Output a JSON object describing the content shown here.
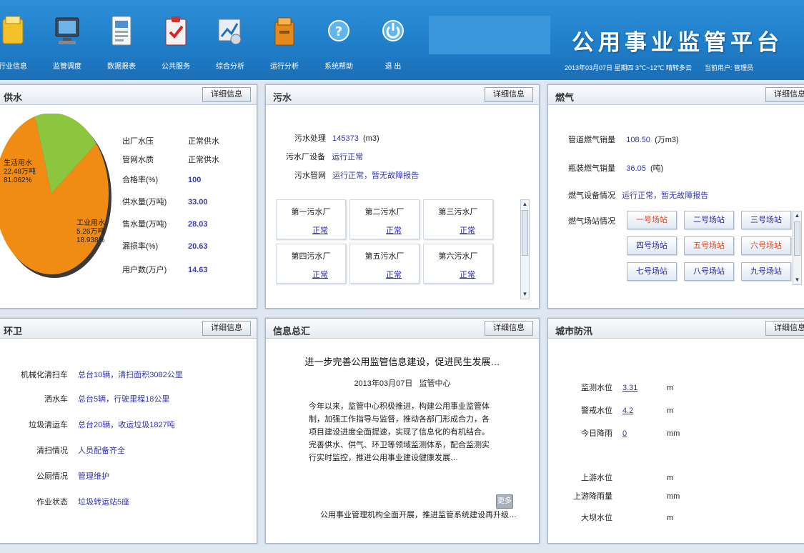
{
  "toolbar": [
    {
      "label": "行业信息",
      "icon": "folder-icon"
    },
    {
      "label": "监管调度",
      "icon": "monitor-icon"
    },
    {
      "label": "数据报表",
      "icon": "report-icon"
    },
    {
      "label": "公共服务",
      "icon": "clipboard-check-icon"
    },
    {
      "label": "综合分析",
      "icon": "chart-analysis-icon"
    },
    {
      "label": "运行分析",
      "icon": "archive-icon"
    },
    {
      "label": "系统帮助",
      "icon": "help-icon"
    },
    {
      "label": "退 出",
      "icon": "exit-icon"
    }
  ],
  "header": {
    "title": "公用事业监管平台",
    "status": [
      "2013年03月07日 星期四 3℃~12℃ 晴转多云",
      "当前用户: 管理员"
    ]
  },
  "common": {
    "detail_label": "详细信息"
  },
  "water": {
    "title": "供水",
    "pie": [
      {
        "name": "生活用水",
        "value": "22.48万吨",
        "pct": "81.062%",
        "color": "#f08c14"
      },
      {
        "name": "工业用水",
        "value": "5.26万吨",
        "pct": "18.938%",
        "color": "#8cc63f"
      }
    ],
    "pie_fractions": [
      0.81062,
      0.18938
    ],
    "stats": [
      {
        "k": "出厂水压",
        "v": "正常供水"
      },
      {
        "k": "管网水质",
        "v": "正常供水"
      },
      {
        "k": "合格率(%)",
        "v": "100"
      },
      {
        "k": "供水量(万吨)",
        "v": "33.00"
      },
      {
        "k": "售水量(万吨)",
        "v": "28.03"
      },
      {
        "k": "漏损率(%)",
        "v": "20.63"
      },
      {
        "k": "用户数(万户)",
        "v": "14.63"
      }
    ]
  },
  "sewage": {
    "title": "污水",
    "rows": [
      {
        "k": "污水处理",
        "v": "145373",
        "unit": "(m3)"
      },
      {
        "k": "污水厂设备",
        "v": "运行正常"
      },
      {
        "k": "污水管网",
        "v": "运行正常，暂无故障报告"
      }
    ],
    "plants": [
      {
        "name": "第一污水厂",
        "status": "正常"
      },
      {
        "name": "第二污水厂",
        "status": "正常"
      },
      {
        "name": "第三污水厂",
        "status": "正常"
      },
      {
        "name": "第四污水厂",
        "status": "正常"
      },
      {
        "name": "第五污水厂",
        "status": "正常"
      },
      {
        "name": "第六污水厂",
        "status": "正常"
      }
    ]
  },
  "gas": {
    "title": "燃气",
    "rows": [
      {
        "k": "管道燃气销量",
        "v": "108.50",
        "unit": "(万m3)"
      },
      {
        "k": "瓶装燃气销量",
        "v": "36.05",
        "unit": "(吨)"
      },
      {
        "k": "燃气设备情况",
        "v": "运行正常，暂无故障报告"
      },
      {
        "k": "燃气场站情况",
        "v": ""
      }
    ],
    "stations": [
      {
        "label": "一号场站",
        "color": "#d24a2a"
      },
      {
        "label": "二号场站",
        "color": "#2a2a9a"
      },
      {
        "label": "三号场站",
        "color": "#2a2a9a"
      },
      {
        "label": "四号场站",
        "color": "#2a2a9a"
      },
      {
        "label": "五号场站",
        "color": "#d24a2a"
      },
      {
        "label": "六号场站",
        "color": "#d24a2a"
      },
      {
        "label": "七号场站",
        "color": "#2a2a9a"
      },
      {
        "label": "八号场站",
        "color": "#2a2a9a"
      },
      {
        "label": "九号场站",
        "color": "#2a2a9a"
      }
    ]
  },
  "sanitation": {
    "title": "环卫",
    "rows": [
      {
        "k": "机械化清扫车",
        "v": "总台10辆，清扫面积3082公里"
      },
      {
        "k": "洒水车",
        "v": "总台5辆，行驶里程18公里"
      },
      {
        "k": "垃圾清运车",
        "v": "总台20辆，收运垃圾1827吨"
      },
      {
        "k": "清扫情况",
        "v": "人员配备齐全"
      },
      {
        "k": "公厕情况",
        "v": "管理维护"
      },
      {
        "k": "作业状态",
        "v": "垃圾转运站5座"
      }
    ]
  },
  "info": {
    "title": "信息总汇",
    "news_title": "进一步完善公用监管信息建设，促进民生发展…",
    "news_date": "2013年03月07日",
    "news_source": "监管中心",
    "news_body": "今年以来，监管中心积极推进，构建公用事业监管体制，加强工作指导与监督，推动各部门形成合力，各项目建设进度全面提速，实现了信息化的有机结合。完善供水、供气、环卫等领域监测体系，配合监测实行实时监控，推进公用事业建设健康发展…",
    "news_footer": "公用事业管理机构全面开展，推进监管系统建设再升级…",
    "more_label": "更多"
  },
  "flood": {
    "title": "城市防汛",
    "rows": [
      {
        "k": "监测水位",
        "v": "3.31",
        "unit": "m"
      },
      {
        "k": "警戒水位",
        "v": "4.2",
        "unit": "m"
      },
      {
        "k": "今日降雨",
        "v": "0",
        "unit": "mm"
      },
      {
        "k": "上游水位",
        "v": "",
        "unit": "m"
      },
      {
        "k": "上游降雨量",
        "v": "",
        "unit": "mm"
      },
      {
        "k": "大坝水位",
        "v": "",
        "unit": "m"
      }
    ]
  }
}
